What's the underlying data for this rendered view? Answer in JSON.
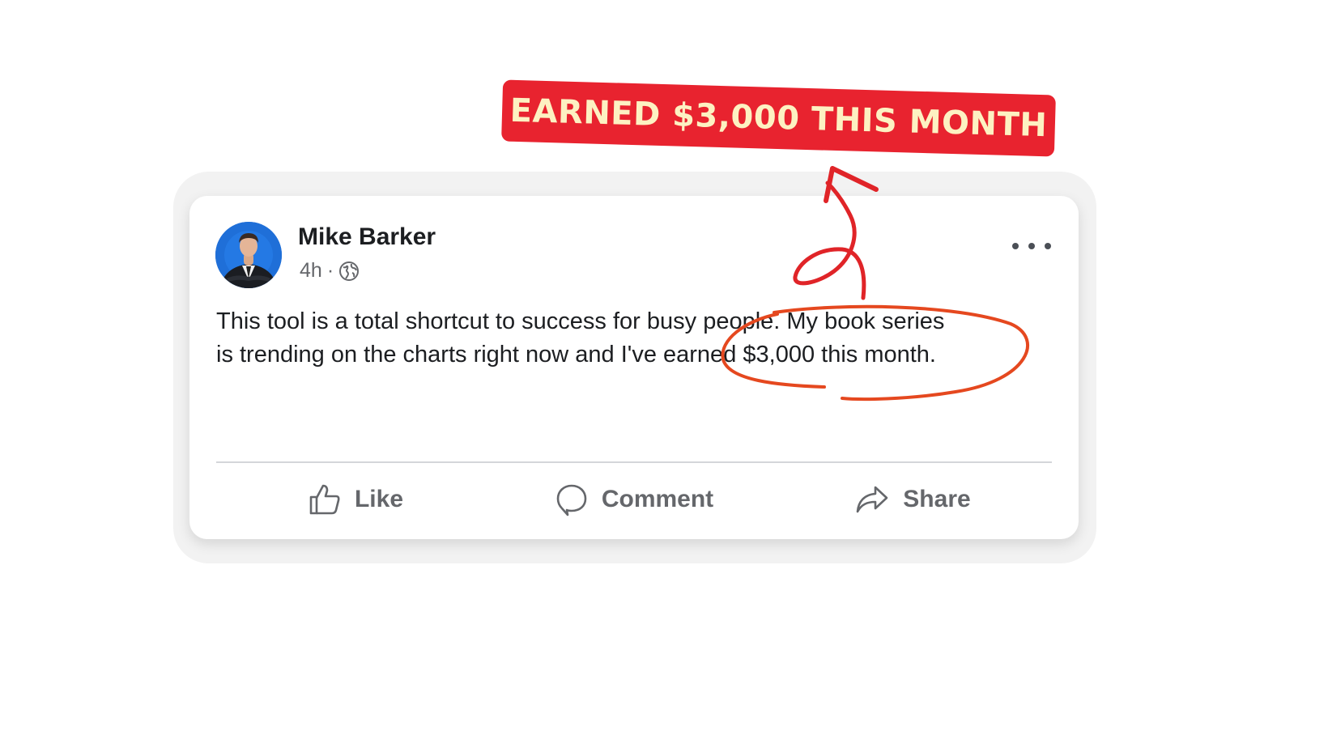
{
  "banner": {
    "text": "EARNED $3,000 THIS MONTH"
  },
  "post": {
    "author": "Mike Barker",
    "time": "4h",
    "separator": "·",
    "visibility_icon": "globe-icon",
    "line1": "This tool is a total shortcut to success for busy people. My book series",
    "line2": "is trending on the charts right now and I've earned $3,000 this month."
  },
  "actions": {
    "like": "Like",
    "comment": "Comment",
    "share": "Share"
  },
  "colors": {
    "banner_bg": "#e8232f",
    "banner_text": "#fdf1c2",
    "annotation_red": "#e02428",
    "circle_orange": "#e5481f"
  }
}
